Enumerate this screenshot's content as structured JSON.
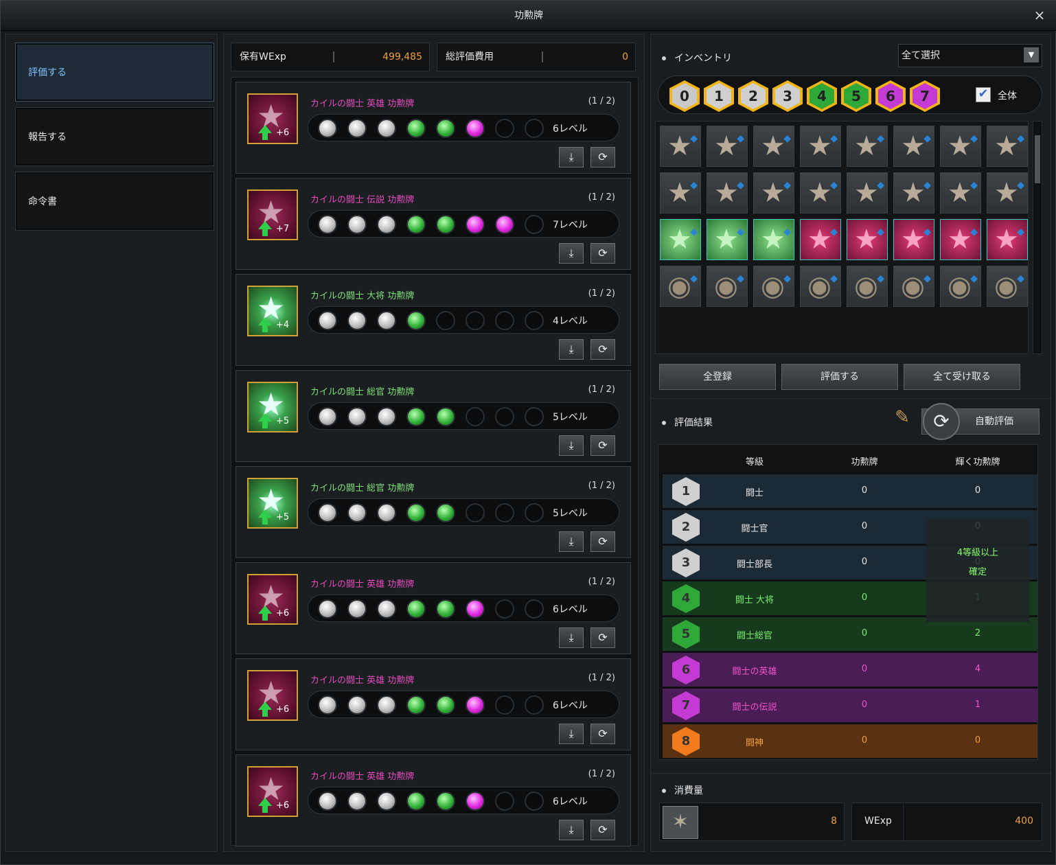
{
  "window": {
    "title": "功勲牌",
    "close_glyph": "×"
  },
  "nav": {
    "items": [
      {
        "label": "評価する",
        "active": true
      },
      {
        "label": "報告する",
        "active": false
      },
      {
        "label": "命令書",
        "active": false
      }
    ]
  },
  "stats": {
    "held_label": "保有WExp",
    "held_value": "499,485",
    "cost_label": "総評価費用",
    "cost_value": "0"
  },
  "cards": [
    {
      "name": "カイルの闘士 英雄 功勲牌",
      "count": "(1 / 2)",
      "plus": "+6",
      "level": "6レベル",
      "medal_color": "pink",
      "name_color": "pink",
      "dots": [
        "white",
        "white",
        "white",
        "green",
        "green",
        "purple",
        "empty",
        "empty"
      ]
    },
    {
      "name": "カイルの闘士 伝説 功勲牌",
      "count": "(1 / 2)",
      "plus": "+7",
      "level": "7レベル",
      "medal_color": "pink",
      "name_color": "pink",
      "dots": [
        "white",
        "white",
        "white",
        "green",
        "green",
        "purple",
        "purple",
        "empty"
      ]
    },
    {
      "name": "カイルの闘士 大将 功勲牌",
      "count": "(1 / 2)",
      "plus": "+4",
      "level": "4レベル",
      "medal_color": "green",
      "name_color": "green",
      "dots": [
        "white",
        "white",
        "white",
        "green",
        "empty",
        "empty",
        "empty",
        "empty"
      ]
    },
    {
      "name": "カイルの闘士 総官 功勲牌",
      "count": "(1 / 2)",
      "plus": "+5",
      "level": "5レベル",
      "medal_color": "green",
      "name_color": "green",
      "dots": [
        "white",
        "white",
        "white",
        "green",
        "green",
        "empty",
        "empty",
        "empty"
      ]
    },
    {
      "name": "カイルの闘士 総官 功勲牌",
      "count": "(1 / 2)",
      "plus": "+5",
      "level": "5レベル",
      "medal_color": "green",
      "name_color": "green",
      "dots": [
        "white",
        "white",
        "white",
        "green",
        "green",
        "empty",
        "empty",
        "empty"
      ]
    },
    {
      "name": "カイルの闘士 英雄 功勲牌",
      "count": "(1 / 2)",
      "plus": "+6",
      "level": "6レベル",
      "medal_color": "pink",
      "name_color": "pink",
      "dots": [
        "white",
        "white",
        "white",
        "green",
        "green",
        "purple",
        "empty",
        "empty"
      ]
    },
    {
      "name": "カイルの闘士 英雄 功勲牌",
      "count": "(1 / 2)",
      "plus": "+6",
      "level": "6レベル",
      "medal_color": "pink",
      "name_color": "pink",
      "dots": [
        "white",
        "white",
        "white",
        "green",
        "green",
        "purple",
        "empty",
        "empty"
      ]
    },
    {
      "name": "カイルの闘士 英雄 功勲牌",
      "count": "(1 / 2)",
      "plus": "+6",
      "level": "6レベル",
      "medal_color": "pink",
      "name_color": "pink",
      "dots": [
        "white",
        "white",
        "white",
        "green",
        "green",
        "purple",
        "empty",
        "empty"
      ]
    }
  ],
  "card_buttons": {
    "register_icon": "download-icon",
    "reset_icon": "refresh-icon"
  },
  "inventory": {
    "title": "インベントリ",
    "select_value": "全て選択",
    "tiers": [
      {
        "label": "0",
        "color": "#c9c9c9"
      },
      {
        "label": "1",
        "color": "#cfcfcf"
      },
      {
        "label": "2",
        "color": "#cfcfcf"
      },
      {
        "label": "3",
        "color": "#cfcfcf"
      },
      {
        "label": "4",
        "color": "#2fa83a"
      },
      {
        "label": "5",
        "color": "#2fa83a"
      },
      {
        "label": "6",
        "color": "#c43bd3"
      },
      {
        "label": "7",
        "color": "#c43bd3"
      }
    ],
    "all_checked": true,
    "all_label": "全体",
    "rows": [
      [
        "gray",
        "gray",
        "gray",
        "gray",
        "gray",
        "gray",
        "gray",
        "gray"
      ],
      [
        "gray",
        "gray",
        "gray",
        "gray",
        "gray",
        "gray",
        "gray",
        "gray"
      ],
      [
        "green",
        "green",
        "green",
        "pink",
        "pink",
        "pink",
        "pink",
        "pink"
      ],
      [
        "coin",
        "coin",
        "coin",
        "coin",
        "coin",
        "coin",
        "coin",
        "coin"
      ]
    ],
    "buttons": {
      "register_all": "全登録",
      "evaluate": "評価する",
      "receive_all": "全て受け取る"
    }
  },
  "results": {
    "title": "評価結果",
    "auto_label": "自動評価",
    "headers": {
      "grade": "等級",
      "medal": "功勲牌",
      "shining": "輝く功勲牌"
    },
    "cover_line1": "4等級以上",
    "cover_line2": "確定",
    "rows": [
      {
        "num": "1",
        "grade": "闘士",
        "medal": "0",
        "shining": "0",
        "hex": "#cfcfcf",
        "bg": "#1b2a34",
        "text": "#e8e8e8"
      },
      {
        "num": "2",
        "grade": "闘士官",
        "medal": "0",
        "shining": "0",
        "hex": "#cfcfcf",
        "bg": "#1b2a34",
        "text": "#e8e8e8"
      },
      {
        "num": "3",
        "grade": "闘士部長",
        "medal": "0",
        "shining": "0",
        "hex": "#cfcfcf",
        "bg": "#1b2a34",
        "text": "#e8e8e8"
      },
      {
        "num": "4",
        "grade": "闘士 大将",
        "medal": "0",
        "shining": "1",
        "hex": "#2fa83a",
        "bg": "#173a1e",
        "text": "#78f06a"
      },
      {
        "num": "5",
        "grade": "闘士総官",
        "medal": "0",
        "shining": "2",
        "hex": "#2fa83a",
        "bg": "#173a1e",
        "text": "#78f06a"
      },
      {
        "num": "6",
        "grade": "闘士の英雄",
        "medal": "0",
        "shining": "4",
        "hex": "#c43bd3",
        "bg": "#4a1d56",
        "text": "#ef55c8"
      },
      {
        "num": "7",
        "grade": "闘士の伝説",
        "medal": "0",
        "shining": "1",
        "hex": "#c43bd3",
        "bg": "#4a1d56",
        "text": "#ef55c8"
      },
      {
        "num": "8",
        "grade": "闘神",
        "medal": "0",
        "shining": "0",
        "hex": "#f07a1c",
        "bg": "#5a3212",
        "text": "#f5a03c"
      }
    ]
  },
  "consumption": {
    "title": "消費量",
    "material_value": "8",
    "wexp_label": "WExp",
    "wexp_value": "400"
  }
}
